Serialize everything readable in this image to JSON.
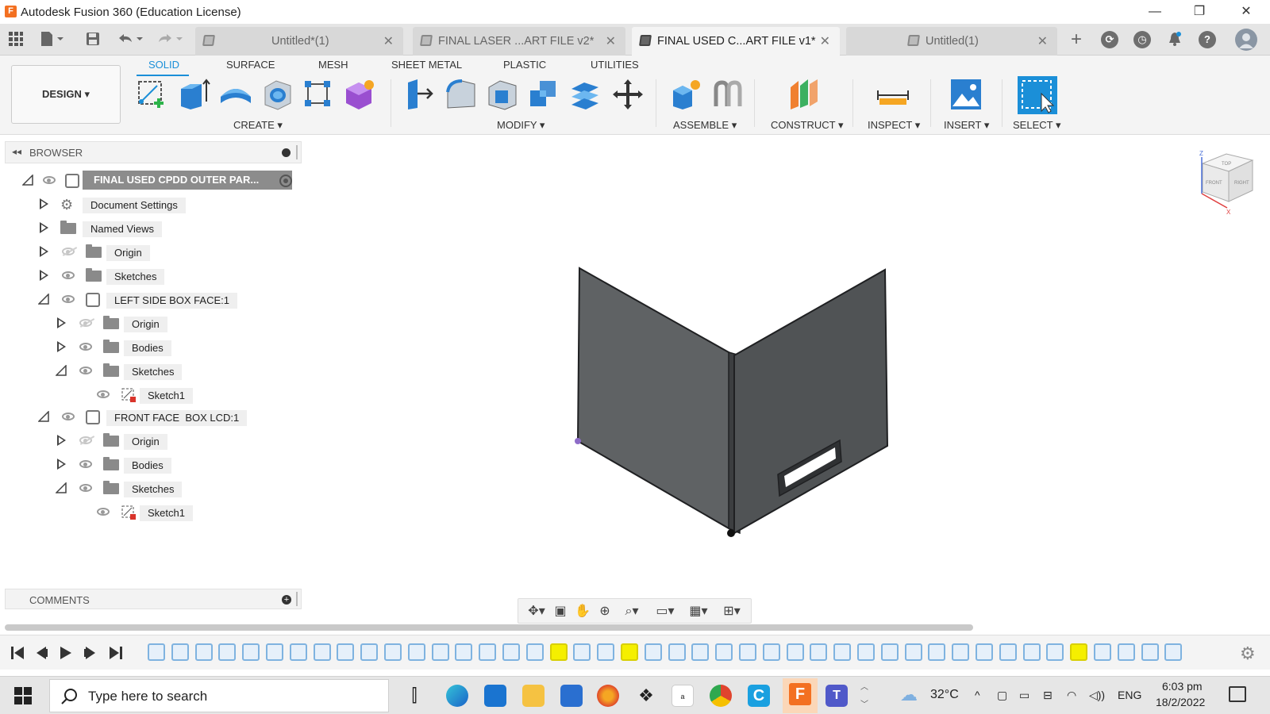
{
  "window": {
    "title": "Autodesk Fusion 360 (Education License)",
    "logo_letter": "F",
    "minimize": "—",
    "maximize": "❐",
    "close": "✕"
  },
  "doc_tabs": [
    {
      "label": "Untitled*(1)",
      "active": false
    },
    {
      "label": "FINAL LASER ...ART FILE v2*",
      "active": false
    },
    {
      "label": "FINAL USED C...ART FILE v1*",
      "active": true
    },
    {
      "label": "Untitled(1)",
      "active": false
    }
  ],
  "tab_close": "✕",
  "ribbon": {
    "tabs": [
      "SOLID",
      "SURFACE",
      "MESH",
      "SHEET METAL",
      "PLASTIC",
      "UTILITIES"
    ],
    "active_tab": "SOLID",
    "workspace": "DESIGN ▾",
    "groups": [
      "CREATE ▾",
      "MODIFY ▾",
      "ASSEMBLE ▾",
      "CONSTRUCT ▾",
      "INSPECT ▾",
      "INSERT ▾",
      "SELECT ▾"
    ]
  },
  "browser": {
    "title": "BROWSER",
    "root": "FINAL USED CPDD OUTER PAR...",
    "items": [
      {
        "label": "Document Settings"
      },
      {
        "label": "Named Views"
      },
      {
        "label": "Origin"
      },
      {
        "label": "Sketches"
      },
      {
        "label": "LEFT SIDE BOX FACE:1"
      },
      {
        "label": "Origin"
      },
      {
        "label": "Bodies"
      },
      {
        "label": "Sketches"
      },
      {
        "label": "Sketch1"
      },
      {
        "label": "FRONT FACE  BOX LCD:1"
      },
      {
        "label": "Origin"
      },
      {
        "label": "Bodies"
      },
      {
        "label": "Sketches"
      },
      {
        "label": "Sketch1"
      }
    ]
  },
  "comments": {
    "title": "COMMENTS"
  },
  "viewcube": {
    "top": "TOP",
    "front": "FRONT",
    "right": "RIGHT",
    "axis_z": "Z",
    "axis_x": "X"
  },
  "taskbar": {
    "search_placeholder": "Type here to search",
    "temperature": "32°C",
    "language": "ENG",
    "time": "6:03 pm",
    "date": "18/2/2022"
  },
  "colors": {
    "accent": "#1b8fd8",
    "timeline_highlight": "#f5ef00",
    "model_face": "#5f6264"
  }
}
